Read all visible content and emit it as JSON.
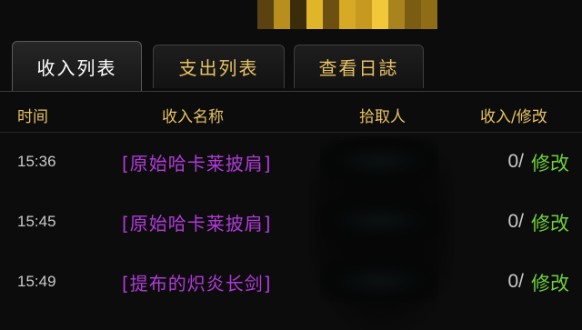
{
  "tabs": [
    {
      "label": "收入列表",
      "active": true
    },
    {
      "label": "支出列表",
      "active": false
    },
    {
      "label": "查看日誌",
      "active": false
    }
  ],
  "columns": {
    "time": "时间",
    "item_name": "收入名称",
    "looter": "拾取人",
    "income_edit": "收入/修改"
  },
  "rows": [
    {
      "time": "15:36",
      "item": "[原始哈卡莱披肩]",
      "count": "0/",
      "edit": "修改"
    },
    {
      "time": "15:45",
      "item": "[原始哈卡莱披肩]",
      "count": "0/",
      "edit": "修改"
    },
    {
      "time": "15:49",
      "item": "[提布的炽炎长剑]",
      "count": "0/",
      "edit": "修改"
    }
  ],
  "colors": {
    "accent_gold": "#e8c262",
    "epic_purple": "#b03ad8",
    "edit_green": "#6fd13a"
  }
}
